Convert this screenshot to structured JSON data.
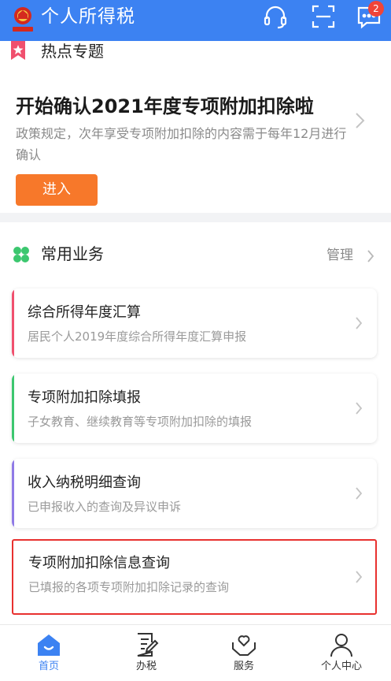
{
  "header": {
    "app_title": "个人所得税",
    "logo_icon": "tax-emblem-icon",
    "icons": [
      "headset-icon",
      "scan-icon",
      "message-icon"
    ],
    "message_badge": "2",
    "bg_color": "#3c82f2"
  },
  "hot_topic": {
    "section_title": "热点专题",
    "headline": "开始确认2021年度专项附加扣除啦",
    "description": "政策规定，次年享受专项附加扣除的内容需于每年12月进行确认",
    "enter_label": "进入",
    "enter_color": "#f7782a"
  },
  "common": {
    "section_title": "常用业务",
    "manage_label": "管理",
    "items": [
      {
        "title": "综合所得年度汇算",
        "subtitle": "居民个人2019年度综合所得年度汇算申报",
        "accent": "#f0506e"
      },
      {
        "title": "专项附加扣除填报",
        "subtitle": "子女教育、继续教育等专项附加扣除的填报",
        "accent": "#3cc76f"
      },
      {
        "title": "收入纳税明细查询",
        "subtitle": "已申报收入的查询及异议申诉",
        "accent": "#8f7ae6"
      },
      {
        "title": "专项附加扣除信息查询",
        "subtitle": "已填报的各项专项附加扣除记录的查询",
        "accent": "#e8312f",
        "highlighted": true
      }
    ]
  },
  "tabbar": {
    "tabs": [
      {
        "label": "首页",
        "icon": "home-icon",
        "active": true
      },
      {
        "label": "办税",
        "icon": "document-edit-icon",
        "active": false
      },
      {
        "label": "服务",
        "icon": "heart-hands-icon",
        "active": false
      },
      {
        "label": "个人中心",
        "icon": "user-icon",
        "active": false
      }
    ],
    "active_color": "#3c82f2"
  }
}
